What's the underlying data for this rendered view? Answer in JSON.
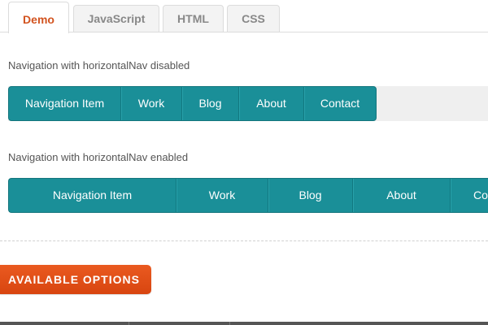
{
  "tabs": [
    {
      "label": "Demo",
      "active": true
    },
    {
      "label": "JavaScript",
      "active": false
    },
    {
      "label": "HTML",
      "active": false
    },
    {
      "label": "CSS",
      "active": false
    }
  ],
  "section_disabled": {
    "label": "Navigation with horizontalNav disabled",
    "items": [
      "Navigation Item",
      "Work",
      "Blog",
      "About",
      "Contact"
    ]
  },
  "section_enabled": {
    "label": "Navigation with horizontalNav enabled",
    "items": [
      "Navigation Item",
      "Work",
      "Blog",
      "About",
      "Contact"
    ]
  },
  "options_button": {
    "label": "AVAILABLE OPTIONS"
  },
  "colors": {
    "nav_bg": "#1a8f98",
    "active_tab_text": "#d2531f",
    "options_button_bg": "#e0501a",
    "nav_track_bg": "#efefef"
  }
}
